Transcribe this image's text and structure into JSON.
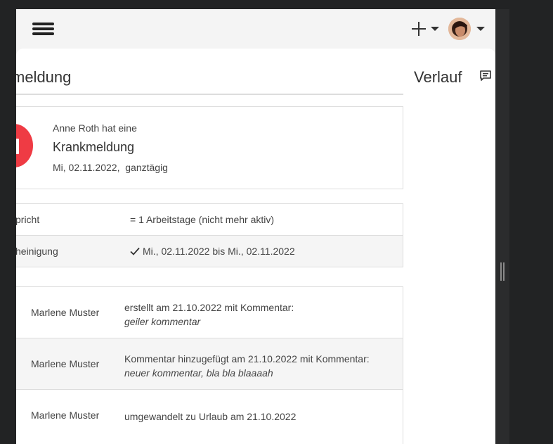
{
  "header": {
    "menu_icon": "hamburger-menu-icon",
    "add_icon": "plus-icon",
    "user_icon": "avatar"
  },
  "page": {
    "title": "meldung"
  },
  "summary": {
    "line1": "Anne Roth hat eine",
    "type": "Krankmeldung",
    "date": "Mi, 02.11.2022,  ganztägig"
  },
  "details": [
    {
      "label": "spricht",
      "value": "= 1 Arbeitstage (nicht mehr aktiv)"
    },
    {
      "label": "cheinigung",
      "value": "Mi., 02.11.2022 bis Mi., 02.11.2022"
    }
  ],
  "history": [
    {
      "who": "Marlene Muster",
      "text": "erstellt am 21.10.2022 mit Kommentar:",
      "note": "geiler kommentar"
    },
    {
      "who": "Marlene Muster",
      "text": "Kommentar hinzugefügt am 21.10.2022 mit Kommentar:",
      "note": "neuer kommentar, bla bla blaaaah"
    },
    {
      "who": "Marlene Muster",
      "text": "umgewandelt zu Urlaub am 21.10.2022",
      "note": ""
    }
  ],
  "sidebar": {
    "title": "Verlauf",
    "comment_icon": "comment-icon"
  },
  "colors": {
    "accent_red": "#ef3b44",
    "background": "#222324"
  }
}
